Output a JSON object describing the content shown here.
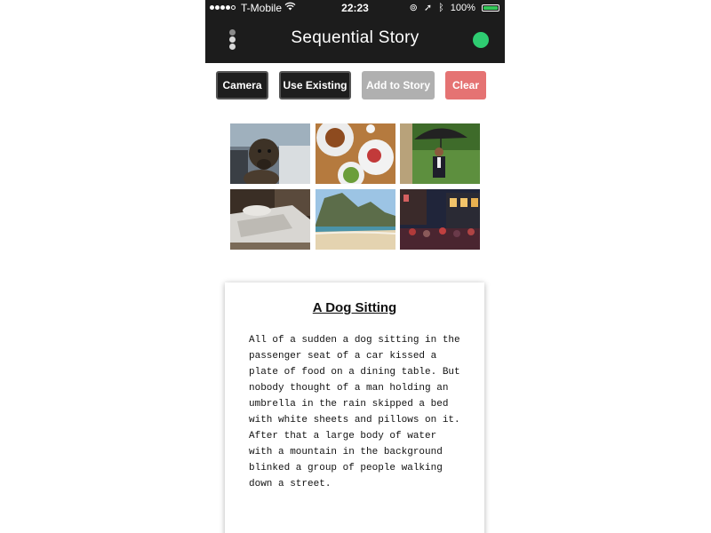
{
  "statusbar": {
    "carrier": "T-Mobile",
    "time": "22:23",
    "battery": "100%",
    "battery_level": 1.0,
    "signal_bars": 4,
    "icons": [
      "wifi-icon",
      "rotation-lock-icon",
      "location-icon",
      "bluetooth-icon",
      "battery-icon"
    ]
  },
  "nav": {
    "title": "Sequential Story",
    "status_color": "#2ecc71"
  },
  "actions": {
    "camera": "Camera",
    "use_existing": "Use Existing",
    "add_to_story": "Add to Story",
    "clear": "Clear"
  },
  "photos": [
    {
      "subject": "dog-in-car"
    },
    {
      "subject": "plate-of-food"
    },
    {
      "subject": "man-with-umbrella"
    },
    {
      "subject": "bed-with-sheets"
    },
    {
      "subject": "beach-with-mountain"
    },
    {
      "subject": "people-on-street"
    }
  ],
  "story": {
    "title": "A Dog Sitting",
    "body": "All of a sudden a dog sitting in the\npassenger seat of a car kissed a\nplate of food on a dining table. But\nnobody thought of a man holding an\numbrella in the rain skipped a bed\nwith white sheets and pillows on it.\nAfter that a large body of water\nwith a mountain in the background\nblinked a group of people walking\ndown a street."
  }
}
